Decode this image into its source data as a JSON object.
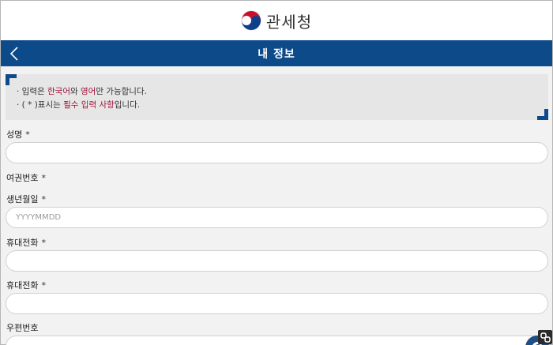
{
  "header": {
    "logo_text": "관세청"
  },
  "navbar": {
    "title": "내 정보"
  },
  "notice": {
    "line1": {
      "p1": "· 입력은 ",
      "hl1": "한국어",
      "p2": "와 ",
      "hl2": "영어",
      "p3": "만 가능합니다."
    },
    "line2": {
      "p1": "· ( * )표시는 ",
      "hl1": "필수 입력 사항",
      "p2": "입니다."
    }
  },
  "form": {
    "name_label": "성명",
    "passport_label": "여권번호",
    "birth_label": "생년월일",
    "birth_placeholder": "YYYYMMDD",
    "phone1_label": "휴대전화",
    "phone2_label": "휴대전화",
    "postal_label": "우편번호",
    "required_mark": "*"
  },
  "colors": {
    "navbar": "#0d4a8a",
    "highlight": "#a3123a",
    "background": "#f2f2f2"
  },
  "icons": {
    "back": "chevron-left-icon",
    "logo": "taegeuk-emblem-icon",
    "corner": "corner-bracket-icon",
    "extension": "link-icon"
  }
}
